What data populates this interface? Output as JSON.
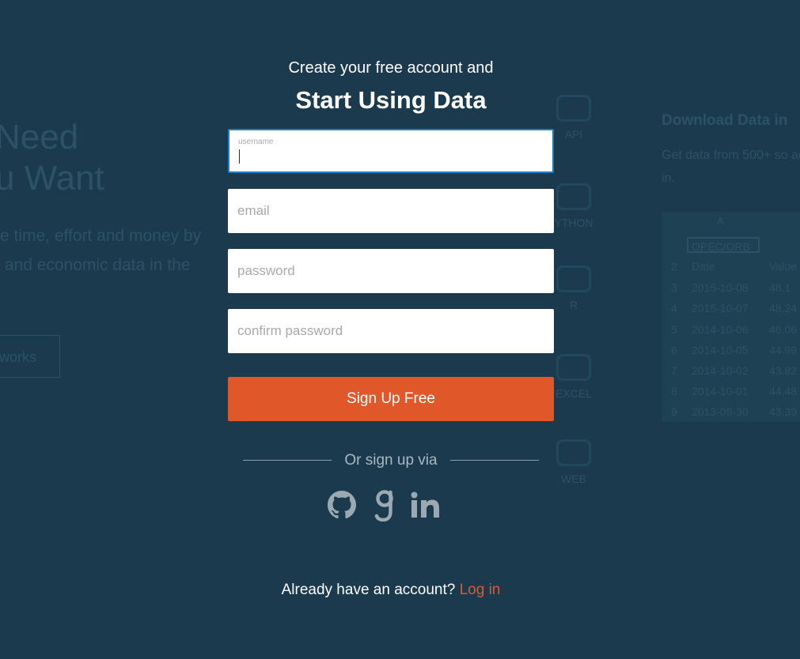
{
  "background": {
    "hero_title": "Need\nu Want",
    "hero_subtitle": "e time, effort and money by\n and economic data in the",
    "how_button": "works",
    "tools": [
      {
        "icon": "code-icon",
        "label": "API"
      },
      {
        "icon": "python-icon",
        "label": "YTHON"
      },
      {
        "icon": "r-icon",
        "label": "R"
      },
      {
        "icon": "excel-icon",
        "label": "EXCEL"
      },
      {
        "icon": "web-icon",
        "label": "WEB"
      }
    ],
    "download_title": "Download Data in",
    "download_sub": "Get data from 500+ so add-in.",
    "sheet": {
      "col_head": "A",
      "ticker": "OPEC/ORB",
      "header": {
        "num": "2",
        "c1": "Date",
        "c2": "Value"
      },
      "rows": [
        {
          "num": "3",
          "c1": "2015-10-08",
          "c2": "48.1"
        },
        {
          "num": "4",
          "c1": "2015-10-07",
          "c2": "48.24"
        },
        {
          "num": "5",
          "c1": "2014-10-06",
          "c2": "46.06"
        },
        {
          "num": "6",
          "c1": "2014-10-05",
          "c2": "44.99"
        },
        {
          "num": "7",
          "c1": "2014-10-02",
          "c2": "43.82"
        },
        {
          "num": "8",
          "c1": "2014-10-01",
          "c2": "44.48"
        },
        {
          "num": "9",
          "c1": "2013-09-30",
          "c2": "43.39"
        }
      ]
    }
  },
  "signup": {
    "intro": "Create your free account and",
    "headline": "Start Using Data",
    "username_label": "username",
    "email_placeholder": "email",
    "password_placeholder": "password",
    "confirm_placeholder": "confirm password",
    "submit_label": "Sign Up Free",
    "divider_text": "Or sign up via",
    "social": [
      "github-icon",
      "google-icon",
      "linkedin-icon"
    ],
    "login_prompt": "Already have an account?",
    "login_link": "Log in"
  },
  "colors": {
    "background": "#1b3a4d",
    "accent": "#e0582a",
    "focus_border": "#1c7fbf",
    "social_icon": "#9aa9b2"
  }
}
